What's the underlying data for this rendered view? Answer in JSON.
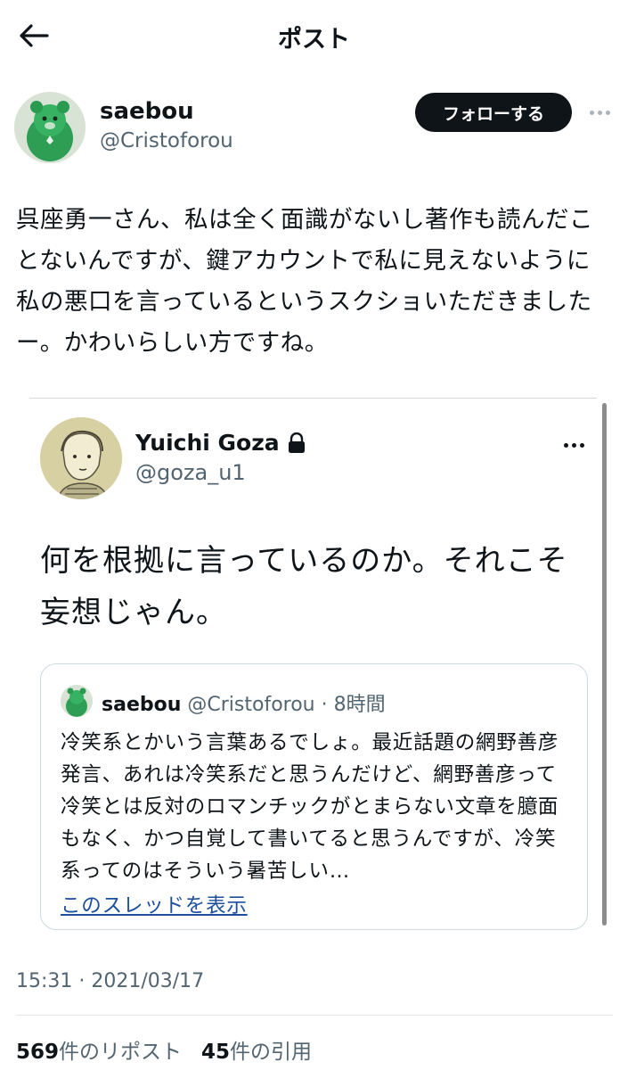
{
  "header": {
    "title": "ポスト"
  },
  "post": {
    "author_name": "saebou",
    "author_handle": "@Cristoforou",
    "follow_label": "フォローする",
    "text": "呉座勇一さん、私は全く面識がないし著作も読んだことないんですが、鍵アカウントで私に見えないように私の悪口を言っているというスクショいただきましたー。かわいらしい方ですね。",
    "timestamp": "15:31 · 2021/03/17"
  },
  "quoted": {
    "name": "Yuichi Goza",
    "handle": "@goza_u1",
    "text": "何を根拠に言っているのか。それこそ妄想じゃん。",
    "card": {
      "name": "saebou",
      "handle": "@Cristoforou",
      "sep": " · ",
      "time": "8時間",
      "text": "冷笑系とかいう言葉あるでしょ。最近話題の網野善彦発言、あれは冷笑系だと思うんだけど、網野善彦って冷笑とは反対のロマンチックがとまらない文章を臆面もなく、かつ自覚して書いてると思うんですが、冷笑系ってのはそういう暑苦しい…",
      "thread_link": "このスレッドを表示"
    }
  },
  "stats": {
    "reposts_count": "569",
    "reposts_label": "件のリポスト",
    "quotes_count": "45",
    "quotes_label": "件の引用"
  }
}
